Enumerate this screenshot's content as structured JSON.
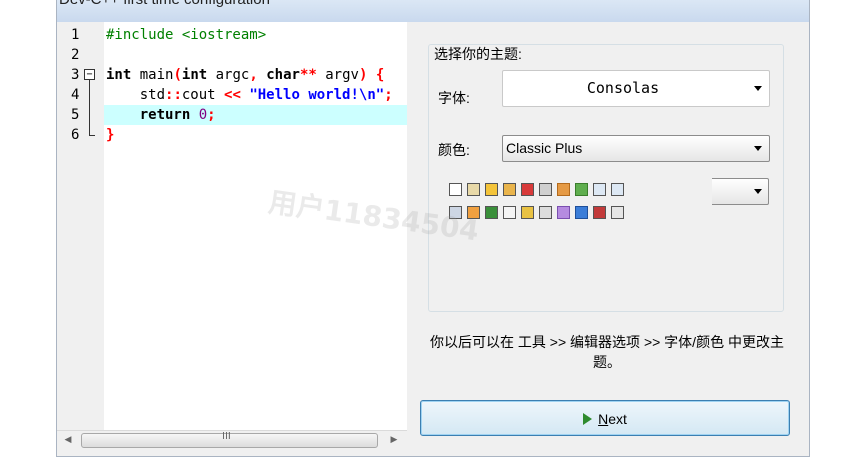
{
  "window": {
    "title": "Dev-C++ first time configuration"
  },
  "editor": {
    "line_numbers": [
      "1",
      "2",
      "3",
      "4",
      "5",
      "6"
    ],
    "fold_symbol": "−"
  },
  "theme": {
    "heading": "选择你的主题:",
    "font_label": "字体:",
    "font_value": "Consolas",
    "color_label": "颜色:",
    "color_value": "Classic Plus"
  },
  "note": "你以后可以在 工具 >> 编辑器选项 >> 字体/颜色 中更改主题。",
  "next_button": {
    "mnemonic": "N",
    "rest": "ext"
  },
  "scrollbar": {
    "grip": "III"
  },
  "watermark": "用户11834504",
  "colors": {
    "preprocessor": "#008000",
    "operator": "#ff0000",
    "string": "#0000ff",
    "number": "#800080",
    "active_line": "#ccffff",
    "button_border": "#3c7fb1"
  },
  "toolbar_icons": [
    "new-file-icon",
    "open-file-icon",
    "save-icon",
    "save-all-icon",
    "close-icon",
    "print-icon",
    "undo-icon",
    "redo-icon",
    "find-icon",
    "replace-icon",
    "project-icon",
    "insert-icon",
    "class-browser-icon",
    "window-icon",
    "color-grid-icon",
    "layout-icon",
    "check-icon",
    "chart-icon",
    "debug-icon",
    "compile-icon"
  ]
}
